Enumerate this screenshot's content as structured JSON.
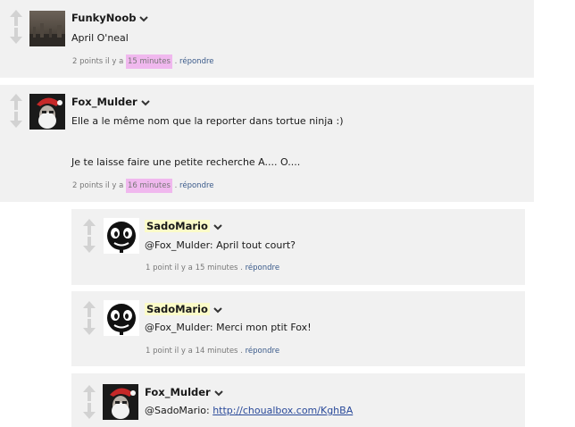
{
  "comments": [
    {
      "user": "FunkyNoob",
      "lines": [
        "April O'neal"
      ],
      "meta": {
        "points": "2 points il y a",
        "time": "15 minutes",
        "sep": ".",
        "reply": "répondre"
      }
    },
    {
      "user": "Fox_Mulder",
      "lines": [
        "Elle a le même nom que la reporter dans tortue ninja :)",
        "Je te laisse faire une petite recherche A.... O...."
      ],
      "meta": {
        "points": "2 points il y a",
        "time": "16 minutes",
        "sep": ".",
        "reply": "répondre"
      }
    }
  ],
  "replies": [
    {
      "user": "SadoMario",
      "text": "@Fox_Mulder: April tout court?",
      "meta": {
        "points": "1 point il y a",
        "time": "15 minutes",
        "sep": ".",
        "reply": "répondre"
      }
    },
    {
      "user": "SadoMario",
      "text": "@Fox_Mulder: Merci mon ptit Fox!",
      "meta": {
        "points": "1 point il y a",
        "time": "14 minutes",
        "sep": ".",
        "reply": "répondre"
      }
    },
    {
      "user": "Fox_Mulder",
      "text_prefix": "@SadoMario: ",
      "link": "http://choualbox.com/KghBA"
    }
  ],
  "icons": {
    "vote_up": "arrow-up-icon",
    "vote_down": "arrow-down-icon",
    "dropdown": "chevron-down-icon"
  },
  "colors": {
    "card_bg": "#f1f1f1",
    "time_highlight": "#f0b8ee",
    "name_highlight": "#fbfbc8",
    "reply_link": "#3a5a8a"
  }
}
